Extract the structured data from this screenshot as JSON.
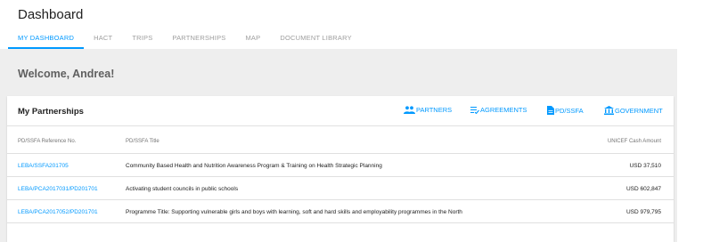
{
  "header": {
    "title": "Dashboard",
    "tabs": [
      {
        "label": "MY DASHBOARD",
        "active": true
      },
      {
        "label": "HACT"
      },
      {
        "label": "TRIPS"
      },
      {
        "label": "PARTNERSHIPS"
      },
      {
        "label": "MAP"
      },
      {
        "label": "DOCUMENT LIBRARY"
      }
    ]
  },
  "welcome": "Welcome, Andrea!",
  "partnerships": {
    "title": "My Partnerships",
    "actions": [
      {
        "label": "PARTNERS",
        "icon": "people-icon"
      },
      {
        "label": "AGREEMENTS",
        "icon": "list-icon"
      },
      {
        "label": "PD/SSFA",
        "icon": "document-icon"
      },
      {
        "label": "GOVERNMENT",
        "icon": "government-building-icon"
      }
    ],
    "columns": [
      "PD/SSFA Reference No.",
      "PD/SSFA Title",
      "UNICEF Cash Amount"
    ],
    "rows": [
      {
        "ref": "LEBA/SSFA201705",
        "title": "Community Based Health and Nutrition Awareness Program & Training on Health Strategic Planning",
        "amount": "USD 37,510"
      },
      {
        "ref": "LEBA/PCA2017031/PD201701",
        "title": "Activating student councils in public schools",
        "amount": "USD 602,847"
      },
      {
        "ref": "LEBA/PCA2017052/PD201701",
        "title": "Programme Title: Supporting vulnerable girls and boys with learning, soft and hard skills and employability programmes in the North",
        "amount": "USD 979,795"
      }
    ]
  },
  "colors": {
    "accent": "#0099ff",
    "background": "#eeeeee",
    "text": "#212121",
    "muted": "#9e9e9e"
  }
}
